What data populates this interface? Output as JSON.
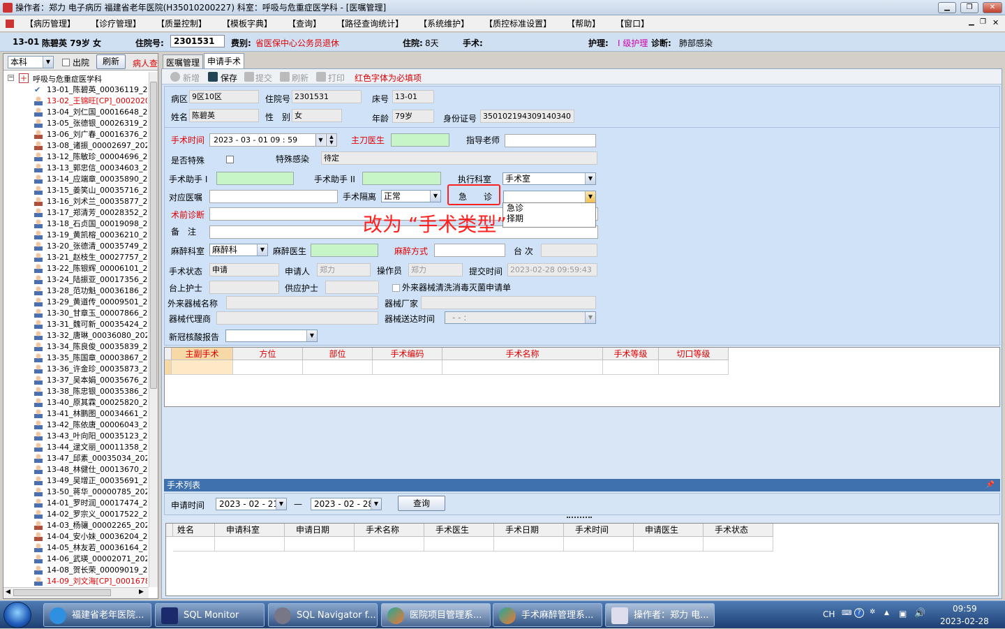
{
  "titlebar": {
    "title": "操作者：郑力 电子病历  福建省老年医院(H35010200227)  科室：呼吸与危重症医学科 - [医嘱管理]"
  },
  "menu": [
    "【病历管理】",
    "【诊疗管理】",
    "【质量控制】",
    "【模板字典】",
    "【查询】",
    "【路径查询统计】",
    "【系统维护】",
    "【质控标准设置】",
    "【帮助】",
    "【窗口】"
  ],
  "patient": {
    "bed": "13-01",
    "name_age_sex": "陈碧英 79岁 女",
    "admission_label": "住院号:",
    "admission_no": "2301531",
    "fee_label": "费别:",
    "fee_value": "省医保中心公务员退休",
    "stay_label": "住院:",
    "stay_value": "8天",
    "surgery_label": "手术:",
    "nursing_label": "护理:",
    "nursing_value": "I 级护理",
    "diag_label": "诊断:",
    "diag_value": "肺部感染"
  },
  "left": {
    "scope": "本科",
    "discharged_label": "出院",
    "refresh_label": "刷新",
    "search_label": "病人查",
    "root": "呼吸与危重症医学科",
    "patients": [
      {
        "t": "13-01_陈碧英_00036119_20",
        "s": "check",
        "red": false
      },
      {
        "t": "13-02_王锦旺[CP]_0002020",
        "s": "m",
        "red": true
      },
      {
        "t": "13-04_刘仁国_00016648_20",
        "s": "m",
        "red": false
      },
      {
        "t": "13-05_张德银_00026319_20",
        "s": "m",
        "red": false
      },
      {
        "t": "13-06_刘广春_00016376_20",
        "s": "f",
        "red": false
      },
      {
        "t": "13-08_诸振_00002697_2023",
        "s": "f",
        "red": false
      },
      {
        "t": "13-12_陈敏珍_00004696_20",
        "s": "m",
        "red": false
      },
      {
        "t": "13-13_郭忠信_00034603_20",
        "s": "m",
        "red": false
      },
      {
        "t": "13-14_应端章_00035890_20",
        "s": "m",
        "red": false
      },
      {
        "t": "13-15_姜笑山_00035716_20",
        "s": "m",
        "red": false
      },
      {
        "t": "13-16_刘术兰_00035877_20",
        "s": "f",
        "red": false
      },
      {
        "t": "13-17_郑清芳_00028352_20",
        "s": "m",
        "red": false
      },
      {
        "t": "13-18_石贞国_00019098_20",
        "s": "m",
        "red": false
      },
      {
        "t": "13-19_黄凯榕_00036210_20",
        "s": "m",
        "red": false
      },
      {
        "t": "13-20_张德清_00035749_20",
        "s": "m",
        "red": false
      },
      {
        "t": "13-21_赵枝生_00027757_20",
        "s": "m",
        "red": false
      },
      {
        "t": "13-22_陈银辉_00006101_20",
        "s": "m",
        "red": false
      },
      {
        "t": "13-24_陆振亚_00017356_20",
        "s": "m",
        "red": false
      },
      {
        "t": "13-28_范功魁_00036186_20",
        "s": "m",
        "red": false
      },
      {
        "t": "13-29_黄道传_00009501_20",
        "s": "m",
        "red": false
      },
      {
        "t": "13-30_甘章玉_00007866_20",
        "s": "m",
        "red": false
      },
      {
        "t": "13-31_魏可新_00035424_20",
        "s": "m",
        "red": false
      },
      {
        "t": "13-32_唐琳_00036080_2023",
        "s": "m",
        "red": false
      },
      {
        "t": "13-34_陈良俊_00035839_20",
        "s": "m",
        "red": false
      },
      {
        "t": "13-35_陈国章_00003867_20",
        "s": "m",
        "red": false
      },
      {
        "t": "13-36_许金珍_00035873_20",
        "s": "m",
        "red": false
      },
      {
        "t": "13-37_吴本娟_00035676_20",
        "s": "m",
        "red": false
      },
      {
        "t": "13-38_陈忠银_00035386_20",
        "s": "m",
        "red": false
      },
      {
        "t": "13-40_原其霖_00025820_20",
        "s": "m",
        "red": false
      },
      {
        "t": "13-41_林鹏图_00034661_20",
        "s": "m",
        "red": false
      },
      {
        "t": "13-42_陈依唐_00006043_20",
        "s": "m",
        "red": false
      },
      {
        "t": "13-43_叶向阳_00035123_20",
        "s": "m",
        "red": false
      },
      {
        "t": "13-44_逯文丽_00011358_20",
        "s": "m",
        "red": false
      },
      {
        "t": "13-47_邱素_00035034_2023",
        "s": "m",
        "red": false
      },
      {
        "t": "13-48_林健仕_00013670_20",
        "s": "m",
        "red": false
      },
      {
        "t": "13-49_吴增正_00035691_20",
        "s": "m",
        "red": false
      },
      {
        "t": "13-50_蒋华_00000785_2023",
        "s": "m",
        "red": false
      },
      {
        "t": "14-01_罗时润_00017474_20",
        "s": "m",
        "red": false
      },
      {
        "t": "14-02_罗宗义_00017522_20",
        "s": "m",
        "red": false
      },
      {
        "t": "14-03_杨骧_00002265_2023",
        "s": "f",
        "red": false
      },
      {
        "t": "14-04_安小妹_00036204_20",
        "s": "f",
        "red": false
      },
      {
        "t": "14-05_林友若_00036164_20",
        "s": "m",
        "red": false
      },
      {
        "t": "14-06_武瑛_00002071_2023",
        "s": "m",
        "red": false
      },
      {
        "t": "14-08_贺长荣_00009019_20",
        "s": "m",
        "red": false
      },
      {
        "t": "14-09_刘文海[CP]_0001678",
        "s": "m",
        "red": true
      }
    ]
  },
  "tabs": {
    "orders": "医嘱管理",
    "surgery": "申请手术"
  },
  "toolbar": {
    "new": "新增",
    "save": "保存",
    "submit": "提交",
    "refresh": "刷新",
    "print": "打印",
    "hint": "红色字体为必填项"
  },
  "form": {
    "ward_label": "病区",
    "ward": "9区10区",
    "adm_label": "住院号",
    "adm": "2301531",
    "bed_label": "床号",
    "bed": "13-01",
    "name_label": "姓名",
    "name": "陈碧英",
    "sex_label": "性　别",
    "sex": "女",
    "age_label": "年龄",
    "age": "79岁",
    "id_label": "身份证号",
    "id": "350102194309140340",
    "optime_label": "手术时间",
    "optime": "2023 - 03 - 01   09 : 59",
    "surgeon_label": "主刀医生",
    "mentor_label": "指导老师",
    "special_label": "是否特殊",
    "infect_label": "特殊感染",
    "infect": "待定",
    "asst1_label": "手术助手 I",
    "asst2_label": "手术助手 II",
    "dept_label": "执行科室",
    "dept": "手术室",
    "order_label": "对应医嘱",
    "iso_label": "手术隔离",
    "iso": "正常",
    "urgent_label": "急　　诊",
    "preop_label": "术前诊断",
    "remark_label": "备　注",
    "anes_dept_label": "麻醉科室",
    "anes_dept": "麻醉科",
    "anes_doc_label": "麻醉医生",
    "anes_method_label": "麻醉方式",
    "table_label": "台 次",
    "status_label": "手术状态",
    "status": "申请",
    "applicant_label": "申请人",
    "applicant": "郑力",
    "operator_label": "操作员",
    "operator": "郑力",
    "submit_time_label": "提交时间",
    "submit_time": "2023-02-28 09:59:43",
    "nurse_label": "台上护士",
    "supply_nurse_label": "供应护士",
    "external_chk_label": "外来器械清洗消毒灭菌申请单",
    "ext_name_label": "外来器械名称",
    "vendor_label": "器械厂家",
    "agent_label": "器械代理商",
    "delivery_label": "器械送达时间",
    "delivery": "-  -       :",
    "covid_label": "新冠核酸报告"
  },
  "urgent_options": [
    "急诊",
    "择期"
  ],
  "annotation": "改为 “手术类型”",
  "grid1": {
    "cols": [
      "主副手术",
      "方位",
      "部位",
      "手术编码",
      "手术名称",
      "手术等级",
      "切口等级"
    ]
  },
  "list": {
    "title": "手术列表",
    "apply_time_label": "申请时间",
    "from": "2023 - 02 - 21",
    "to": "2023 - 02 - 28",
    "dash": "—",
    "query": "查询",
    "cols": [
      "姓名",
      "申请科室",
      "申请日期",
      "手术名称",
      "手术医生",
      "手术日期",
      "手术时间",
      "申请医生",
      "手术状态"
    ]
  },
  "taskbar": {
    "tasks": [
      "福建省老年医院...",
      "SQL Monitor",
      "SQL Navigator f...",
      "医院项目管理系...",
      "手术麻醉管理系...",
      "操作者：郑力 电..."
    ],
    "lang": "CH",
    "time": "09:59",
    "date": "2023-02-28"
  }
}
